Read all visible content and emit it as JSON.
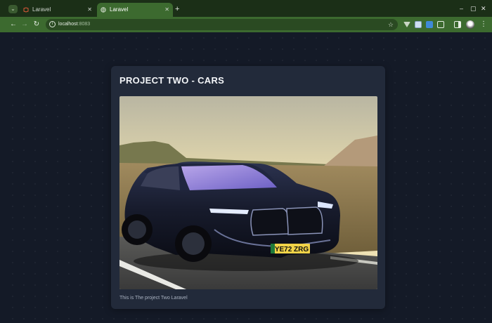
{
  "browser": {
    "tabs": [
      {
        "label": "Laravel",
        "active": false
      },
      {
        "label": "Laravel",
        "active": true
      }
    ],
    "new_tab": "+",
    "url_host": "localhost",
    "url_port": ":8083",
    "window_controls": [
      "–",
      "▢",
      "✕"
    ]
  },
  "card": {
    "title": "PROJECT TWO - CARS",
    "caption": "This is The project Two Laravel",
    "plate": "YE72 ZRG"
  },
  "colors": {
    "tabbar": "#1b2f17",
    "toolbar": "#3c6a2f",
    "page_bg": "#141a27",
    "card_bg": "#222a3a"
  },
  "icons": [
    "tab-search-icon",
    "laravel-favicon",
    "globe-favicon",
    "close-icon",
    "new-tab-icon",
    "back-icon",
    "forward-icon",
    "reload-icon",
    "site-info-icon",
    "bookmark-star-icon",
    "extension-icon",
    "sidebar-icon",
    "profile-avatar-icon",
    "menu-icon"
  ]
}
